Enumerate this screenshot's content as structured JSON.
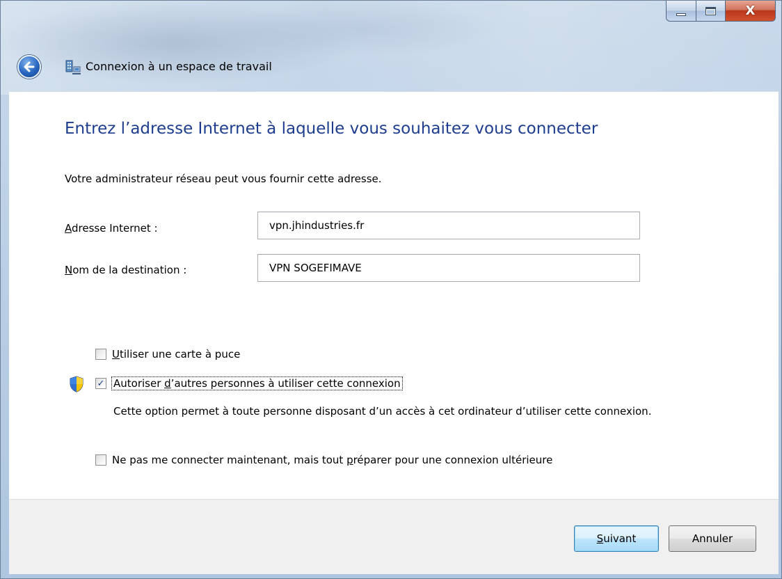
{
  "window": {
    "title": "Connexion à un espace de travail",
    "close_glyph": "X"
  },
  "main": {
    "heading": "Entrez l’adresse Internet à laquelle vous souhaitez vous connecter",
    "info": "Votre administrateur réseau peut vous fournir cette adresse."
  },
  "fields": {
    "address": {
      "label_accel": "A",
      "label_rest": "dresse Internet :",
      "value": "vpn.jhindustries.fr"
    },
    "destination": {
      "label_accel": "N",
      "label_rest": "om de la destination :",
      "value": "VPN SOGEFIMAVE"
    }
  },
  "options": {
    "smartcard": {
      "accel": "U",
      "rest": "tiliser une carte à puce",
      "checked": false
    },
    "allow_others": {
      "pre": "Autoriser ",
      "accel": "d",
      "rest": "’autres personnes à utiliser cette connexion",
      "checked": true
    },
    "allow_others_desc": "Cette option permet à toute personne disposant d’un accès à cet ordinateur d’utiliser cette connexion.",
    "connect_later": {
      "pre": "Ne pas me connecter maintenant, mais tout ",
      "accel": "p",
      "rest": "réparer pour une connexion ultérieure",
      "checked": false
    }
  },
  "buttons": {
    "next_accel": "S",
    "next_rest": "uivant",
    "cancel": "Annuler"
  },
  "icons": {
    "back": "back-arrow-icon",
    "app": "network-workplace-icon",
    "shield": "uac-shield-icon",
    "check": "✓"
  },
  "colors": {
    "heading": "#1e3d8f",
    "accent_button": "#3c7fb1"
  }
}
